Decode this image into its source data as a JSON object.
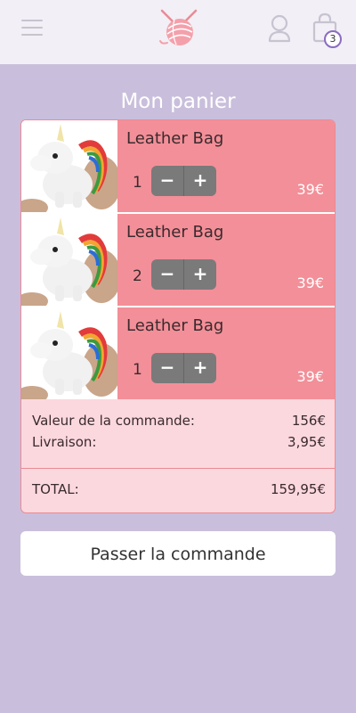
{
  "header": {
    "icons": [
      "menu-icon",
      "yarn-logo-icon",
      "user-icon",
      "shopping-bag-icon"
    ],
    "cart_count": "3",
    "accent_color": "#8a6cc0",
    "background_color": "#f2eff6"
  },
  "page": {
    "title": "Mon panier",
    "background_color": "#c9bfdc"
  },
  "cart": {
    "item_color": "#f38f98",
    "summary_color": "#fbd8de",
    "items": [
      {
        "name": "Leather Bag",
        "quantity": "1",
        "price": "39€",
        "minus": "−",
        "plus": "+"
      },
      {
        "name": "Leather Bag",
        "quantity": "2",
        "price": "39€",
        "minus": "−",
        "plus": "+"
      },
      {
        "name": "Leather Bag",
        "quantity": "1",
        "price": "39€",
        "minus": "−",
        "plus": "+"
      }
    ],
    "summary": {
      "order_value_label": "Valeur de la commande:",
      "order_value": "156€",
      "delivery_label": "Livraison:",
      "delivery_value": "3,95€",
      "total_label": "TOTAL:",
      "total_value": "159,95€"
    }
  },
  "checkout": {
    "label": "Passer la commande"
  }
}
